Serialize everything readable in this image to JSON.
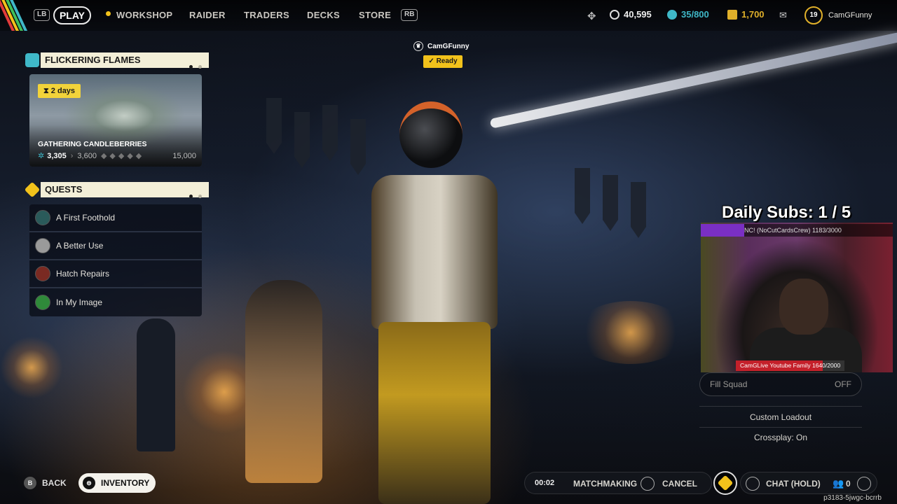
{
  "nav": {
    "lb": "LB",
    "rb": "RB",
    "play": "PLAY",
    "items": [
      "WORKSHOP",
      "RAIDER",
      "TRADERS",
      "DECKS",
      "STORE"
    ]
  },
  "resources": {
    "credits": "40,595",
    "coins": "35/800",
    "tokens": "1,700",
    "level": "19",
    "username": "CamGFunny"
  },
  "event": {
    "title": "FLICKERING FLAMES",
    "timer": "2 days",
    "name": "GATHERING CANDLEBERRIES",
    "progress_current": "3,305",
    "progress_next": "3,600",
    "progress_max": "15,000"
  },
  "quests": {
    "title": "QUESTS",
    "items": [
      {
        "label": "A First Foothold"
      },
      {
        "label": "A Better Use"
      },
      {
        "label": "Hatch Repairs"
      },
      {
        "label": "In My Image"
      }
    ]
  },
  "player": {
    "name": "CamGFunny",
    "status": "Ready"
  },
  "stream": {
    "daily_subs": "Daily Subs: 1 / 5",
    "sub_goal": "NC! (NoCutCardsCrew) 1183/3000",
    "yt_goal": "CamGLive Youtube Family 1640/2000"
  },
  "settings": {
    "fill_squad_label": "Fill Squad",
    "fill_squad_value": "OFF",
    "custom_loadout": "Custom Loadout",
    "crossplay": "Crossplay: On"
  },
  "bottom": {
    "back_key": "B",
    "back": "BACK",
    "inventory": "INVENTORY",
    "mm_time": "00:02",
    "matchmaking": "MATCHMAKING",
    "cancel": "CANCEL",
    "chat": "CHAT (HOLD)",
    "party_count": "0",
    "session_id": "p3183-5jwgc-bcrrb"
  },
  "colors": {
    "accent_yellow": "#f2c21b",
    "panel_head": "#f3efd8",
    "credits_cyan": "#3fb8c8",
    "tokens_gold": "#e0b02a"
  }
}
